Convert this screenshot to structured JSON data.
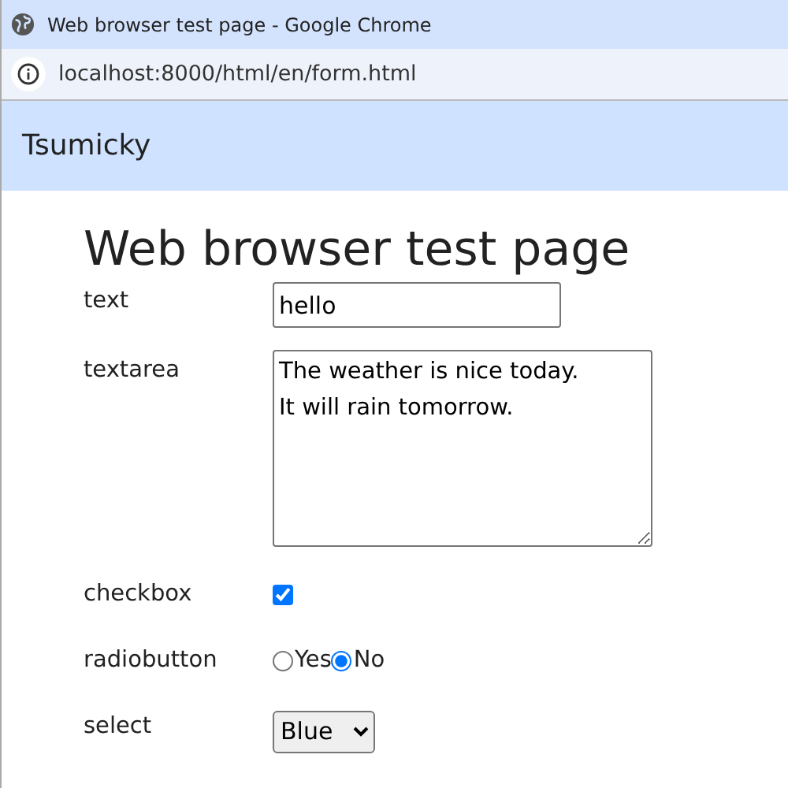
{
  "window": {
    "title": "Web browser test page - Google Chrome"
  },
  "address_bar": {
    "url": "localhost:8000/html/en/form.html"
  },
  "navbar": {
    "brand": "Tsumicky"
  },
  "heading": "Web browser test page",
  "form": [
    {
      "kind": "text",
      "label": "text",
      "value": "hello"
    },
    {
      "kind": "textarea",
      "label": "textarea",
      "value": "The weather is nice today.\nIt will rain tomorrow."
    },
    {
      "kind": "checkbox",
      "label": "checkbox",
      "checked": true
    },
    {
      "kind": "radio",
      "label": "radiobutton",
      "options": [
        {
          "label": "Yes",
          "selected": false
        },
        {
          "label": "No",
          "selected": true
        }
      ]
    },
    {
      "kind": "select",
      "label": "select",
      "value": "Blue"
    }
  ]
}
